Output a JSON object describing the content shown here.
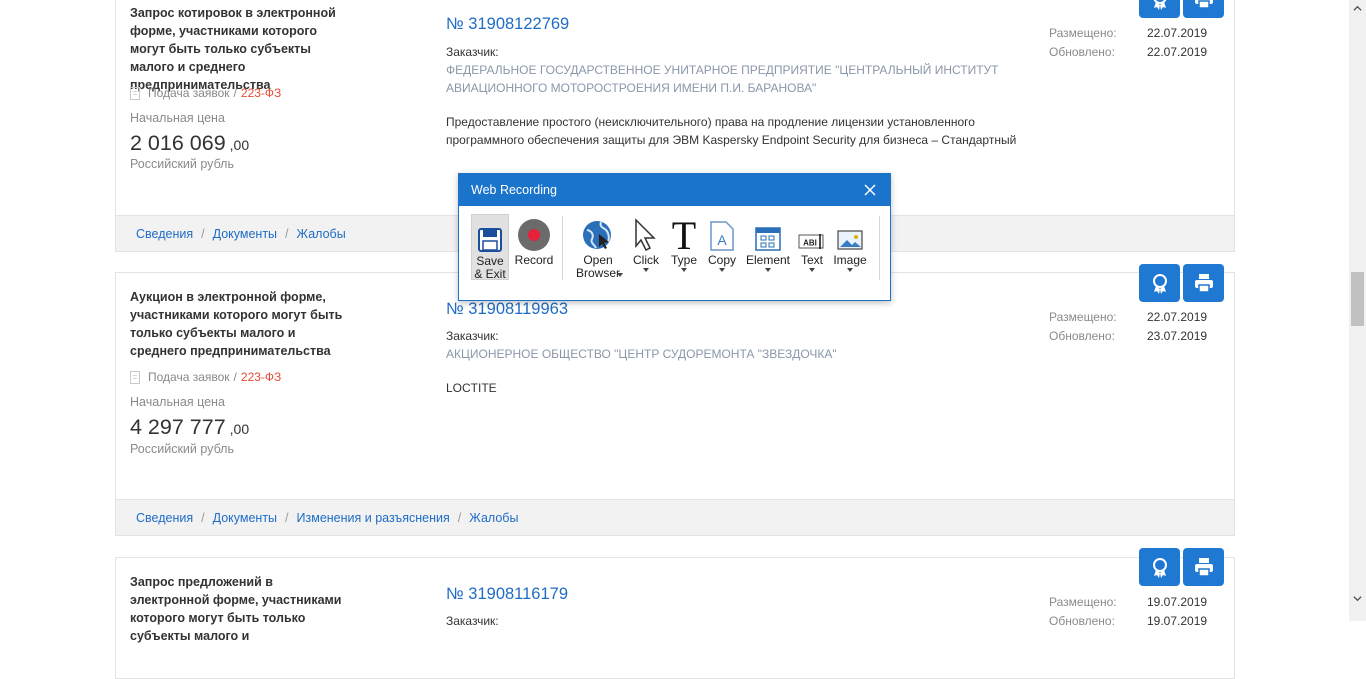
{
  "cards": [
    {
      "type_text": "Запрос котировок в электронной форме, участниками которого могут быть только субъекты малого и среднего предпринимательства",
      "stage": "Подача заявок",
      "law": "223-ФЗ",
      "price_label": "Начальная цена",
      "price_main": "2 016 069",
      "price_cents": ",00",
      "currency": "Российский рубль",
      "number": "№ 31908122769",
      "customer_label": "Заказчик:",
      "customer_name": "ФЕДЕРАЛЬНОЕ ГОСУДАРСТВЕННОЕ УНИТАРНОЕ ПРЕДПРИЯТИЕ \"ЦЕНТРАЛЬНЫЙ ИНСТИТУТ АВИАЦИОННОГО МОТОРОСТРОЕНИЯ ИМЕНИ П.И. БАРАНОВА\"",
      "description": "Предоставление простого (неисключительного) права на продление лицензии установленного программного обеспечения защиты для ЭВМ Kaspersky Endpoint Security для бизнеса – Стандартный",
      "posted_label": "Размещено:",
      "posted": "22.07.2019",
      "updated_label": "Обновлено:",
      "updated": "22.07.2019",
      "links": [
        "Сведения",
        "Документы",
        "Жалобы"
      ]
    },
    {
      "type_text": "Аукцион в электронной форме, участниками которого могут быть только субъекты малого и среднего предпринимательства",
      "stage": "Подача заявок",
      "law": "223-ФЗ",
      "price_label": "Начальная цена",
      "price_main": "4 297 777",
      "price_cents": ",00",
      "currency": "Российский рубль",
      "number": "№ 31908119963",
      "customer_label": "Заказчик:",
      "customer_name": "АКЦИОНЕРНОЕ ОБЩЕСТВО \"ЦЕНТР СУДОРЕМОНТА \"ЗВЕЗДОЧКА\"",
      "description": "LOCTITE",
      "posted_label": "Размещено:",
      "posted": "22.07.2019",
      "updated_label": "Обновлено:",
      "updated": "23.07.2019",
      "links": [
        "Сведения",
        "Документы",
        "Изменения и разъяснения",
        "Жалобы"
      ]
    },
    {
      "type_text": "Запрос предложений в электронной форме, участниками которого могут быть только субъекты малого и",
      "number": "№ 31908116179",
      "customer_label": "Заказчик:",
      "posted_label": "Размещено:",
      "posted": "19.07.2019",
      "updated_label": "Обновлено:",
      "updated": "19.07.2019"
    }
  ],
  "dialog": {
    "title": "Web Recording",
    "tools": {
      "save": "Save\n& Exit",
      "record": "Record",
      "open_browser": "Open\nBrowser",
      "click": "Click",
      "type": "Type",
      "copy": "Copy",
      "element": "Element",
      "text": "Text",
      "image": "Image"
    }
  },
  "icons": {
    "ribbon": "award-icon",
    "print": "printer-icon",
    "document": "document-icon",
    "close": "close-icon"
  },
  "colors": {
    "link": "#1f6cc5",
    "law": "#e34d36",
    "button": "#1f78d1",
    "dialog_title": "#1b74cc"
  }
}
